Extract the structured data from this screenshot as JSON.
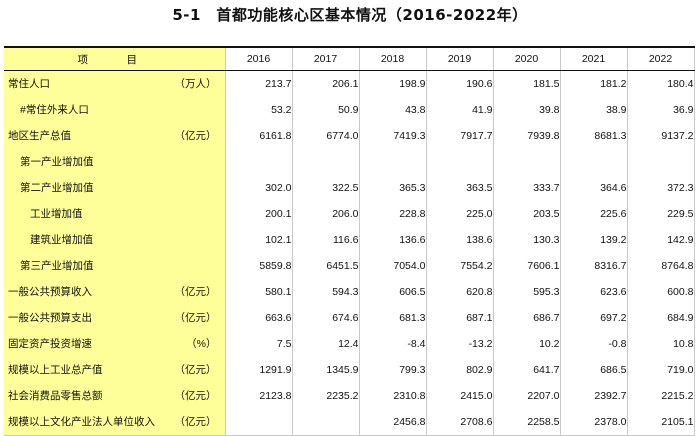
{
  "title": "5-1　首都功能核心区基本情况（2016-2022年）",
  "header": {
    "item_label": "项　目",
    "years": [
      "2016",
      "2017",
      "2018",
      "2019",
      "2020",
      "2021",
      "2022"
    ]
  },
  "rows": [
    {
      "name": "常住人口",
      "unit": "（万人）",
      "values": [
        "213.7",
        "206.1",
        "198.9",
        "190.6",
        "181.5",
        "181.2",
        "180.4"
      ]
    },
    {
      "name": "#常住外来人口",
      "unit": "",
      "values": [
        "53.2",
        "50.9",
        "43.8",
        "41.9",
        "39.8",
        "38.9",
        "36.9"
      ]
    },
    {
      "name": "地区生产总值",
      "unit": "（亿元）",
      "values": [
        "6161.8",
        "6774.0",
        "7419.3",
        "7917.7",
        "7939.8",
        "8681.3",
        "9137.2"
      ]
    },
    {
      "name": "第一产业增加值",
      "unit": "",
      "values": [
        "",
        "",
        "",
        "",
        "",
        "",
        ""
      ]
    },
    {
      "name": "第二产业增加值",
      "unit": "",
      "values": [
        "302.0",
        "322.5",
        "365.3",
        "363.5",
        "333.7",
        "364.6",
        "372.3"
      ]
    },
    {
      "name": "工业增加值",
      "unit": "",
      "values": [
        "200.1",
        "206.0",
        "228.8",
        "225.0",
        "203.5",
        "225.6",
        "229.5"
      ]
    },
    {
      "name": "建筑业增加值",
      "unit": "",
      "values": [
        "102.1",
        "116.6",
        "136.6",
        "138.6",
        "130.3",
        "139.2",
        "142.9"
      ]
    },
    {
      "name": "第三产业增加值",
      "unit": "",
      "values": [
        "5859.8",
        "6451.5",
        "7054.0",
        "7554.2",
        "7606.1",
        "8316.7",
        "8764.8"
      ]
    },
    {
      "name": "一般公共预算收入",
      "unit": "（亿元）",
      "values": [
        "580.1",
        "594.3",
        "606.5",
        "620.8",
        "595.3",
        "623.6",
        "600.8"
      ]
    },
    {
      "name": "一般公共预算支出",
      "unit": "（亿元）",
      "values": [
        "663.6",
        "674.6",
        "681.3",
        "687.1",
        "686.7",
        "697.2",
        "684.9"
      ]
    },
    {
      "name": "固定资产投资增速",
      "unit": "（%）",
      "values": [
        "7.5",
        "12.4",
        "-8.4",
        "-13.2",
        "10.2",
        "-0.8",
        "10.8"
      ]
    },
    {
      "name": "规模以上工业总产值",
      "unit": "（亿元）",
      "values": [
        "1291.9",
        "1345.9",
        "799.3",
        "802.9",
        "641.7",
        "686.5",
        "719.0"
      ]
    },
    {
      "name": "社会消费品零售总额",
      "unit": "（亿元）",
      "values": [
        "2123.8",
        "2235.2",
        "2310.8",
        "2415.0",
        "2207.0",
        "2392.7",
        "2215.2"
      ]
    },
    {
      "name": "规模以上文化产业法人单位收入",
      "unit": "（亿元）",
      "values": [
        "",
        "",
        "2456.8",
        "2708.6",
        "2258.5",
        "2378.0",
        "2105.1"
      ]
    }
  ]
}
